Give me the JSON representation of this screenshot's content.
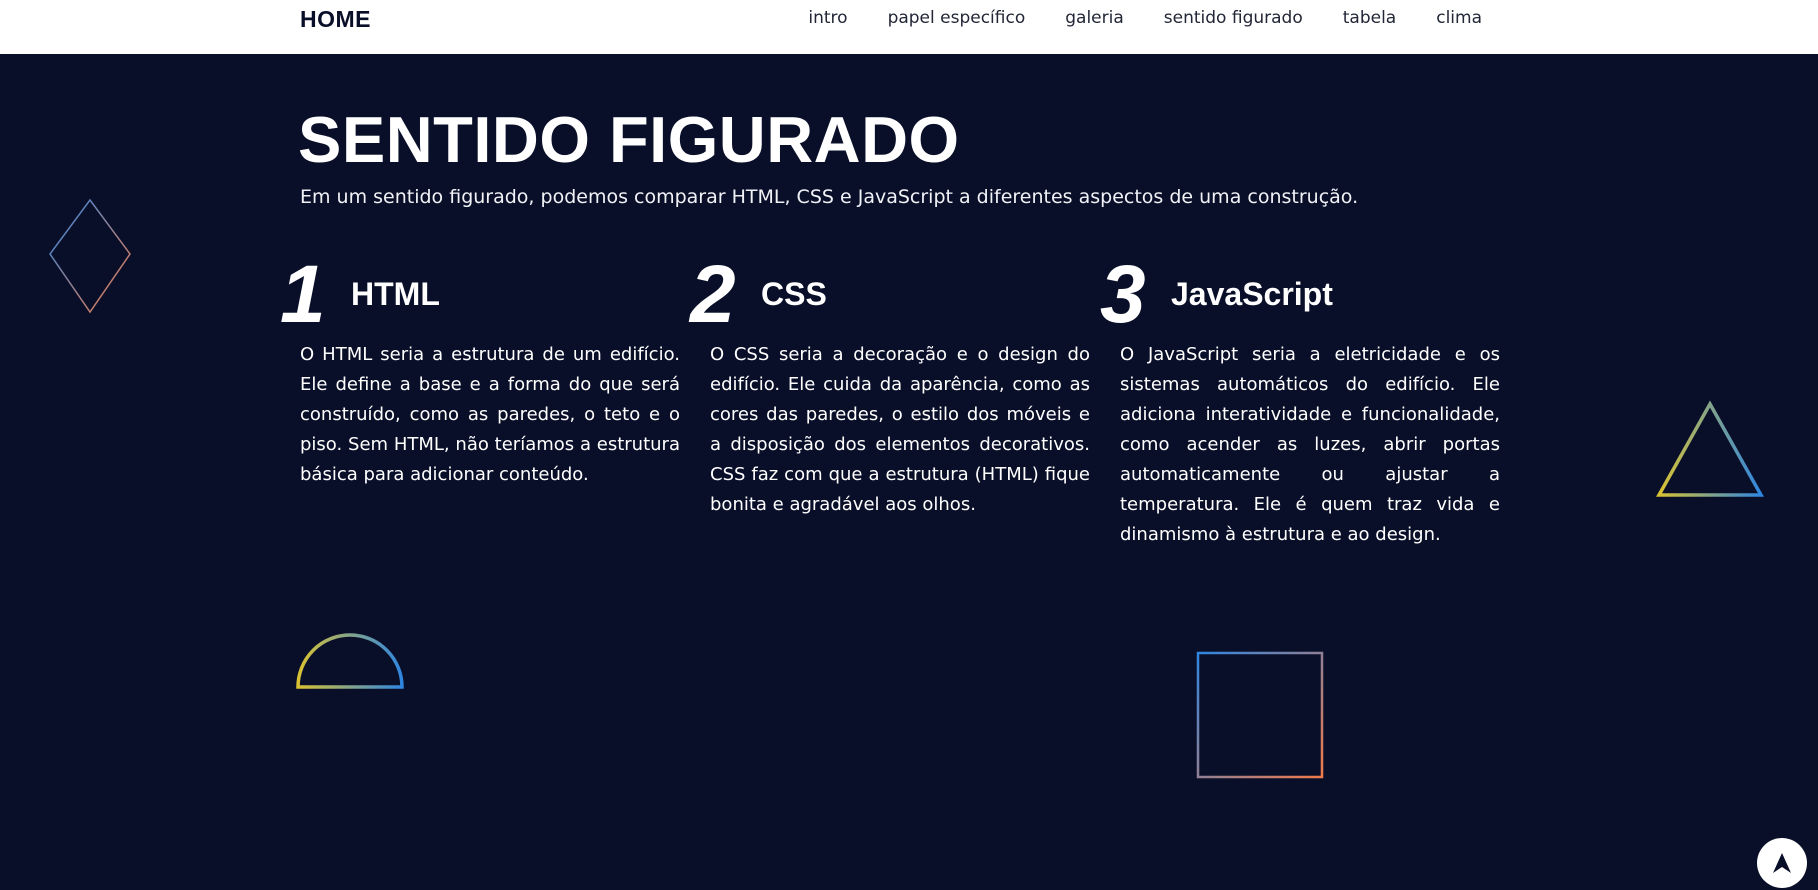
{
  "header": {
    "brand": "HOME",
    "nav": [
      {
        "label": "intro"
      },
      {
        "label": "papel específico"
      },
      {
        "label": "galeria"
      },
      {
        "label": "sentido figurado"
      },
      {
        "label": "tabela"
      },
      {
        "label": "clima"
      }
    ]
  },
  "section": {
    "title": "SENTIDO FIGURADO",
    "subtitle": "Em um sentido figurado, podemos comparar HTML, CSS e JavaScript a diferentes aspectos de uma construção.",
    "columns": [
      {
        "number": "1",
        "title": "HTML",
        "text": "O HTML seria a estrutura de um edifício. Ele define a base e a forma do que será construído, como as paredes, o teto e o piso. Sem HTML, não teríamos a estrutura básica para adicionar conteúdo."
      },
      {
        "number": "2",
        "title": "CSS",
        "text": "O CSS seria a decoração e o design do edifício. Ele cuida da aparência, como as cores das paredes, o estilo dos móveis e a disposição dos elementos decorativos. CSS faz com que a estrutura (HTML) fique bonita e agradável aos olhos."
      },
      {
        "number": "3",
        "title": "JavaScript",
        "text": "O JavaScript seria a eletricidade e os sistemas automáticos do edifício. Ele adiciona interatividade e funcionalidade, como acender as luzes, abrir portas automaticamente ou ajustar a temperatura. Ele é quem traz vida e dinamismo à estrutura e ao design."
      }
    ]
  },
  "decorations": [
    {
      "shape": "diamond-outline"
    },
    {
      "shape": "triangle-outline"
    },
    {
      "shape": "half-circle-outline"
    },
    {
      "shape": "square-outline"
    }
  ],
  "back_to_top": {
    "icon": "arrow-up-icon"
  },
  "colors": {
    "background": "#0a0f29",
    "header_background": "#ffffff",
    "text_light": "#ffffff",
    "text_dark": "#0a0f29",
    "gradient_yellow": "#d9c232",
    "gradient_blue": "#2f86e0",
    "gradient_orange": "#f07a4a"
  }
}
